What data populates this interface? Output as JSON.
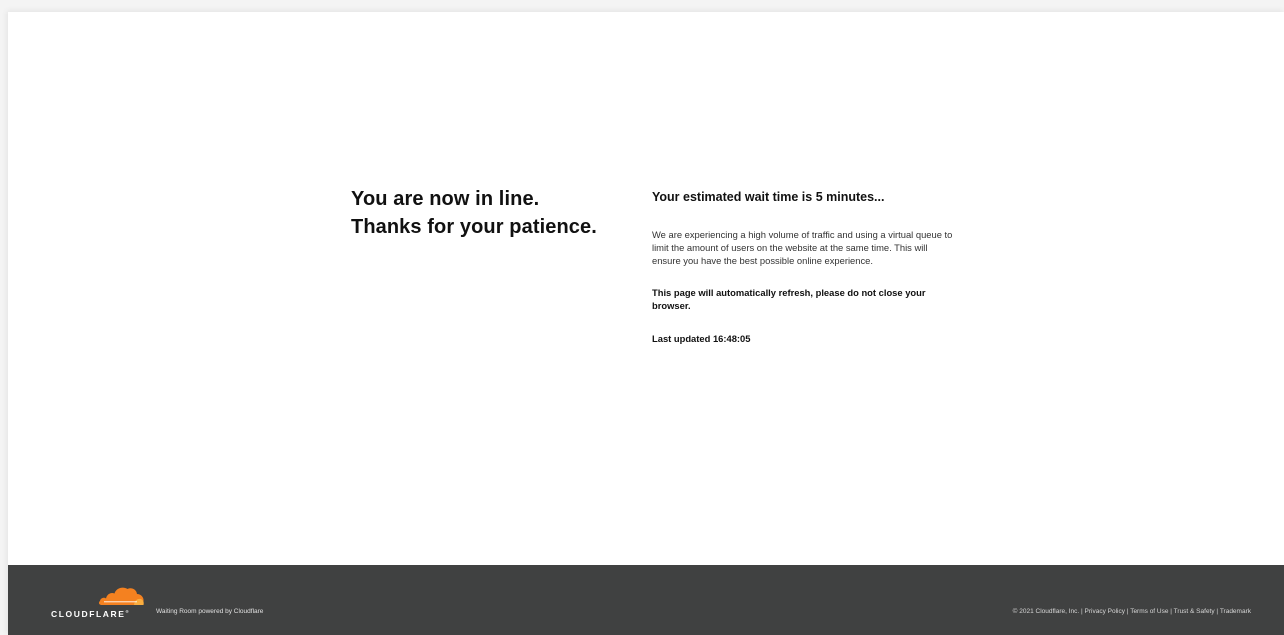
{
  "main": {
    "headline_line1": "You are now in line.",
    "headline_line2": "Thanks for your patience.",
    "wait_title": "Your estimated wait time is 5 minutes...",
    "description": "We are experiencing a high volume of traffic and using a virtual queue to limit the amount of users on the website at the same time. This will ensure you have the best possible online experience.",
    "refresh_notice": "This page will automatically refresh, please do not close your browser.",
    "last_updated": "Last updated 16:48:05"
  },
  "footer": {
    "brand_name": "CLOUDFLARE",
    "brand_mark": "®",
    "powered_by": "Waiting Room powered by Cloudflare",
    "copyright": "© 2021 Cloudflare, Inc.",
    "separator": " | ",
    "links": [
      "Privacy Policy",
      "Terms of Use",
      "Trust & Safety",
      "Trademark"
    ],
    "cloud_icon": "cloudflare-cloud-icon",
    "cloud_color": "#f48120",
    "cloud_color_light": "#faad3f",
    "background_color": "#404141"
  }
}
